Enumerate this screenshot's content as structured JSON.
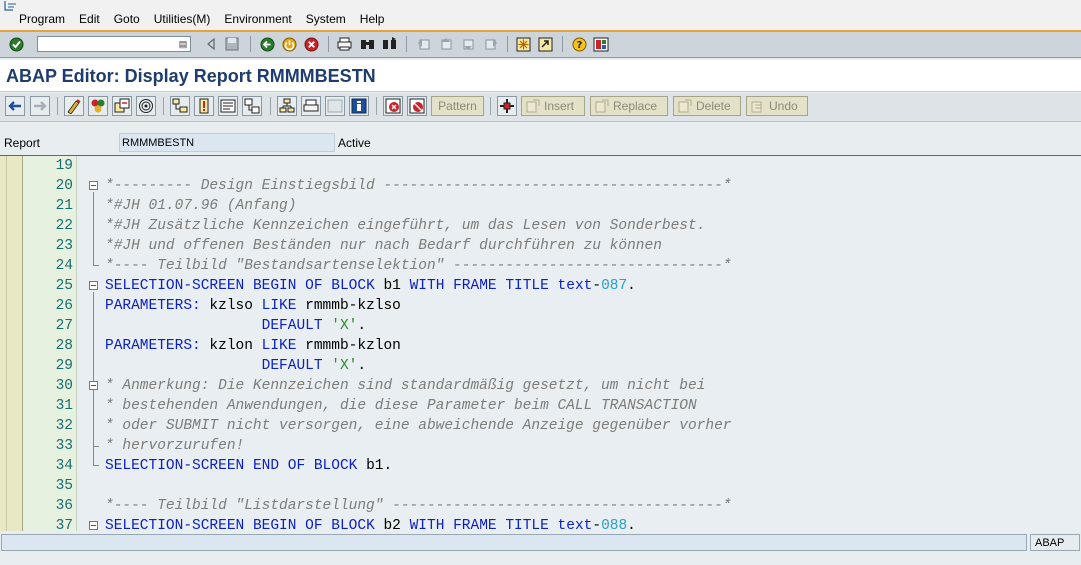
{
  "menu": {
    "items": [
      "Program",
      "Edit",
      "Goto",
      "Utilities(M)",
      "Environment",
      "System",
      "Help"
    ]
  },
  "system_toolbar": {
    "command_field_value": "",
    "icons": [
      "enter-icon",
      "back-icon",
      "exit-icon",
      "cancel-icon",
      "print-icon",
      "find-icon",
      "find-next-icon",
      "first-page-icon",
      "previous-page-icon",
      "next-page-icon",
      "last-page-icon",
      "create-session-icon",
      "shortcut-icon",
      "help-icon",
      "layout-menu-icon"
    ]
  },
  "title": "ABAP Editor: Display Report RMMMBESTN",
  "app_toolbar": {
    "buttons": {
      "pattern": "Pattern",
      "insert": "Insert",
      "replace": "Replace",
      "delete": "Delete",
      "undo": "Undo"
    }
  },
  "report": {
    "label": "Report",
    "value": "RMMMBESTN",
    "status": "Active"
  },
  "code_lines": [
    {
      "n": "19",
      "text": ""
    },
    {
      "n": "20",
      "text": "*--------- Design Einstiegsbild ---------------------------------------*"
    },
    {
      "n": "21",
      "text": "*#JH 01.07.96 (Anfang)"
    },
    {
      "n": "22",
      "text": "*#JH Zusätzliche Kennzeichen eingeführt, um das Lesen von Sonderbest."
    },
    {
      "n": "23",
      "text": "*#JH und offenen Beständen nur nach Bedarf durchführen zu können"
    },
    {
      "n": "24",
      "text": "*---- Teilbild \"Bestandsartenselektion\" -------------------------------*"
    },
    {
      "n": "25",
      "text": "SELECTION-SCREEN BEGIN OF BLOCK b1 WITH FRAME TITLE text-087."
    },
    {
      "n": "26",
      "text": "PARAMETERS: kzlso LIKE rmmmb-kzlso"
    },
    {
      "n": "27",
      "text": "                  DEFAULT 'X'."
    },
    {
      "n": "28",
      "text": "PARAMETERS: kzlon LIKE rmmmb-kzlon"
    },
    {
      "n": "29",
      "text": "                  DEFAULT 'X'."
    },
    {
      "n": "30",
      "text": "* Anmerkung: Die Kennzeichen sind standardmäßig gesetzt, um nicht bei"
    },
    {
      "n": "31",
      "text": "* bestehenden Anwendungen, die diese Parameter beim CALL TRANSACTION"
    },
    {
      "n": "32",
      "text": "* oder SUBMIT nicht versorgen, eine abweichende Anzeige gegenüber vorher"
    },
    {
      "n": "33",
      "text": "* hervorzurufen!"
    },
    {
      "n": "34",
      "text": "SELECTION-SCREEN END OF BLOCK b1."
    },
    {
      "n": "35",
      "text": ""
    },
    {
      "n": "36",
      "text": "*---- Teilbild \"Listdarstellung\" --------------------------------------*"
    },
    {
      "n": "37",
      "text": "SELECTION-SCREEN BEGIN OF BLOCK b2 WITH FRAME TITLE text-088."
    }
  ],
  "status_bar": {
    "message": "",
    "system": "ABAP"
  },
  "colors": {
    "keyword": "#0b1fc4",
    "comment": "#7c7c7c",
    "string": "#2f8a2f",
    "number": "#2ba0c4",
    "title": "#1e3d6e",
    "accent": "#e8a23b"
  }
}
